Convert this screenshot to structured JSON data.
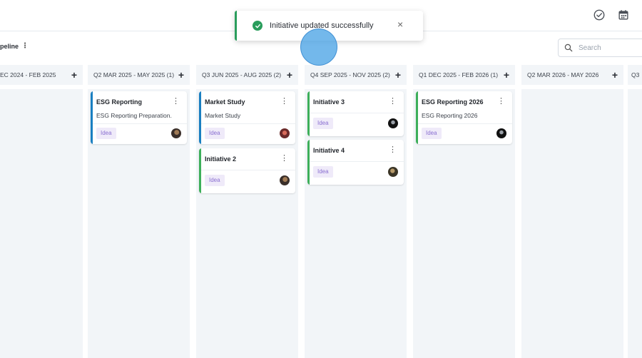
{
  "topbar": {
    "check_icon": "check-circle-icon",
    "calendar_icon": "calendar-icon"
  },
  "pipeline": {
    "label": "peline"
  },
  "search": {
    "placeholder": "Search"
  },
  "toast": {
    "message": "Initiative updated successfully",
    "close": "×"
  },
  "columns": [
    {
      "title": "EC 2024 - FEB 2025",
      "add": "+"
    },
    {
      "title": "Q2 MAR 2025 - MAY 2025 (1)",
      "add": "+"
    },
    {
      "title": "Q3 JUN 2025 - AUG 2025 (2)",
      "add": "+"
    },
    {
      "title": "Q4 SEP 2025 - NOV 2025 (2)",
      "add": "+"
    },
    {
      "title": "Q1 DEC 2025 - FEB 2026 (1)",
      "add": "+"
    },
    {
      "title": "Q2 MAR 2026 - MAY 2026",
      "add": "+"
    },
    {
      "title": "Q3",
      "add": ""
    }
  ],
  "cards": {
    "esg_reporting": {
      "title": "ESG Reporting",
      "desc": "ESG Reporting Preparation.",
      "tag": "Idea",
      "color": "#1a7fc1"
    },
    "market_study": {
      "title": "Market Study",
      "desc": "Market Study",
      "tag": "Idea",
      "color": "#1a7fc1"
    },
    "initiative_2": {
      "title": "Initiative 2",
      "tag": "Idea",
      "color": "#3daf5a"
    },
    "initiative_3": {
      "title": "Initiative 3",
      "tag": "Idea",
      "color": "#3daf5a"
    },
    "initiative_4": {
      "title": "Initiative 4",
      "tag": "Idea",
      "color": "#3daf5a"
    },
    "esg_reporting_2026": {
      "title": "ESG Reporting 2026",
      "desc": "ESG Reporting 2026",
      "tag": "Idea",
      "color": "#3daf5a"
    }
  },
  "menu_glyph": "⋮"
}
